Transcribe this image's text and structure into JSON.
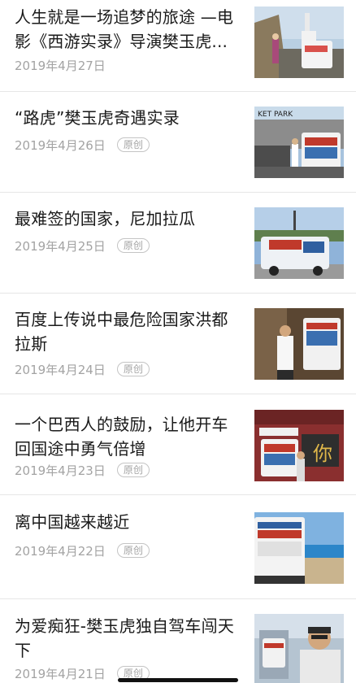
{
  "articles": [
    {
      "title": "人生就是一场追梦的旅途 —电影《西游实录》导演樊玉虎...",
      "date": "2019年4月27日",
      "badge": ""
    },
    {
      "title": "“路虎”樊玉虎奇遇实录",
      "date": "2019年4月26日",
      "badge": "原创"
    },
    {
      "title": "最难签的国家，尼加拉瓜",
      "date": "2019年4月25日",
      "badge": "原创"
    },
    {
      "title": "百度上传说中最危险国家洪都拉斯",
      "date": "2019年4月24日",
      "badge": "原创"
    },
    {
      "title": "一个巴西人的鼓励，让他开车回国途中勇气倍增",
      "date": "2019年4月23日",
      "badge": "原创"
    },
    {
      "title": "离中国越来越近",
      "date": "2019年4月22日",
      "badge": "原创"
    },
    {
      "title": "为爱痴狂-樊玉虎独自驾车闯天下",
      "date": "2019年4月21日",
      "badge": "原创"
    }
  ],
  "thumbnail_text": {
    "park_sign": "KET PARK",
    "banner_1": "",
    "sign_ni": "你"
  },
  "colors": {
    "title": "#1a1a1a",
    "meta": "#a3a3a3",
    "divider": "#e6e6e6",
    "badge_border": "#c4c4c4"
  }
}
